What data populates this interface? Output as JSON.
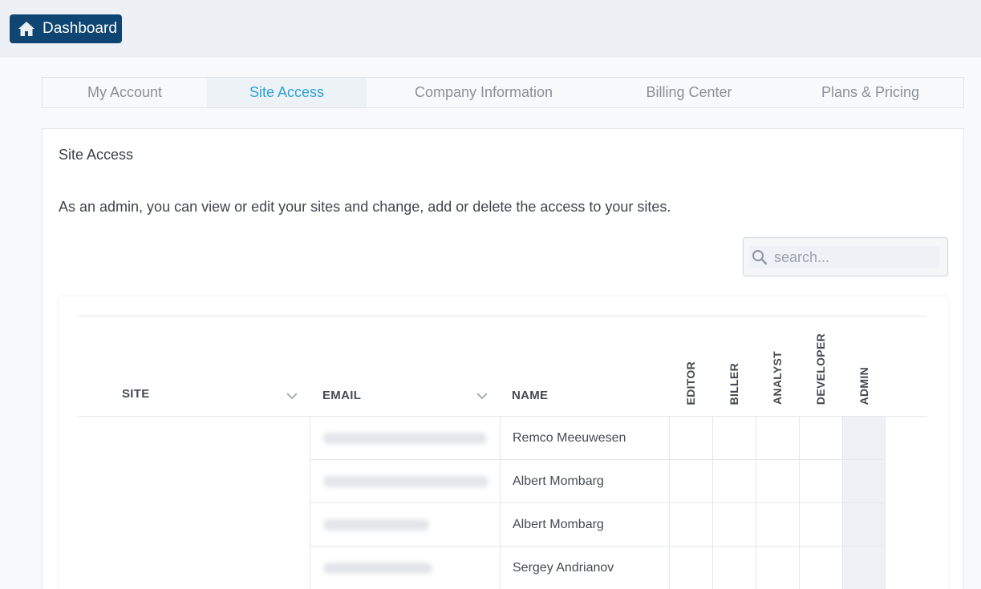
{
  "topbar": {
    "dashboard_label": "Dashboard",
    "dashboard_icon": "home-icon"
  },
  "tabs": [
    {
      "label": "My Account",
      "active": false
    },
    {
      "label": "Site Access",
      "active": true
    },
    {
      "label": "Company Information",
      "active": false
    },
    {
      "label": "Billing Center",
      "active": false
    },
    {
      "label": "Plans & Pricing",
      "active": false
    }
  ],
  "panel": {
    "title": "Site Access",
    "description": "As an admin, you can view or edit your sites and change, add or delete the access to your sites."
  },
  "search": {
    "placeholder": "search...",
    "value": ""
  },
  "table": {
    "columns": {
      "site": "SITE",
      "email": "EMAIL",
      "name": "NAME",
      "editor": "EDITOR",
      "biller": "BILLER",
      "analyst": "ANALYST",
      "developer": "DEVELOPER",
      "admin": "ADMIN"
    },
    "rows": [
      {
        "site": "",
        "email": "",
        "name": "Remco Meeuwesen"
      },
      {
        "site": "",
        "email": "",
        "name": "Albert Mombarg"
      },
      {
        "site": "",
        "email": "",
        "name": "Albert Mombarg"
      },
      {
        "site": "",
        "email": "",
        "name": "Sergey Andrianov"
      }
    ]
  },
  "colors": {
    "accent": "#2aa3d7",
    "dashboard_button": "#0f4572",
    "topbar_bg": "#edf1f6",
    "admin_column_bg": "#eef2f6"
  }
}
